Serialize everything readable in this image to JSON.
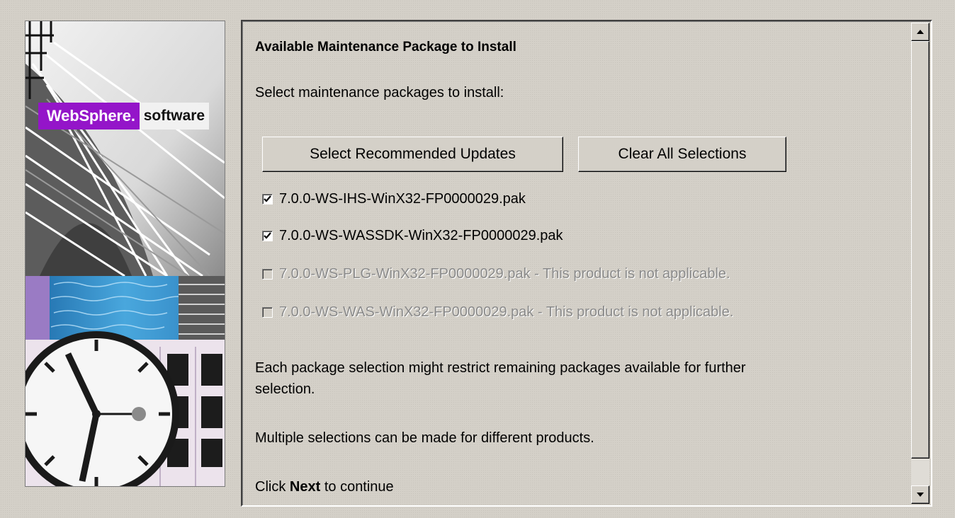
{
  "banner": {
    "brand_primary": "WebSphere.",
    "brand_secondary": "software",
    "brand_color": "#9415c9"
  },
  "panel": {
    "title": "Available Maintenance Package to Install",
    "instruction": "Select maintenance packages to install:",
    "buttons": {
      "select_recommended": "Select Recommended Updates",
      "clear_all": "Clear All Selections"
    },
    "packages": [
      {
        "label": "7.0.0-WS-IHS-WinX32-FP0000029.pak",
        "checked": true,
        "enabled": true
      },
      {
        "label": "7.0.0-WS-WASSDK-WinX32-FP0000029.pak",
        "checked": true,
        "enabled": true
      },
      {
        "label": "7.0.0-WS-PLG-WinX32-FP0000029.pak - This product is not applicable.",
        "checked": false,
        "enabled": false
      },
      {
        "label": "7.0.0-WS-WAS-WinX32-FP0000029.pak - This product is not applicable.",
        "checked": false,
        "enabled": false
      }
    ],
    "note_line1": "Each package selection might restrict remaining packages available for further",
    "note_line2": "selection.",
    "note_multiple": "Multiple selections can be made for different products.",
    "click_prefix": "Click",
    "click_next": "Next",
    "click_suffix": "to continue"
  },
  "scrollbar": {
    "up_icon": "arrow-up-icon",
    "down_icon": "arrow-down-icon"
  }
}
